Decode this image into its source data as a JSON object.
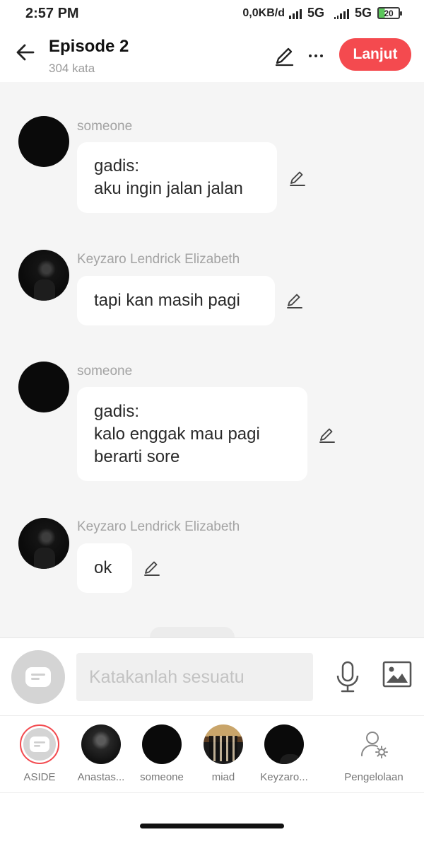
{
  "status_bar": {
    "time": "2:57 PM",
    "data_speed": "0,0KB/d",
    "network_1": "5G",
    "network_2": "5G",
    "battery": "20"
  },
  "header": {
    "title": "Episode 2",
    "word_count": "304 kata",
    "next_label": "Lanjut",
    "accent_color": "#f44a4f"
  },
  "messages": [
    {
      "sender": "someone",
      "lines": [
        "gadis:",
        "aku ingin jalan jalan"
      ]
    },
    {
      "sender": "Keyzaro Lendrick Elizabeth",
      "lines": [
        "tapi kan masih pagi"
      ]
    },
    {
      "sender": "someone",
      "lines": [
        "gadis:",
        "kalo enggak mau pagi",
        "berarti sore"
      ]
    },
    {
      "sender": "Keyzaro Lendrick Elizabeth",
      "lines": [
        "ok"
      ]
    }
  ],
  "input": {
    "placeholder": "Katakanlah sesuatu",
    "value": ""
  },
  "characters": [
    {
      "label": "ASIDE",
      "icon": "aside-icon",
      "selected": true
    },
    {
      "label": "Anastas...",
      "icon": "avatar"
    },
    {
      "label": "someone",
      "icon": "avatar"
    },
    {
      "label": "miad",
      "icon": "avatar"
    },
    {
      "label": "Keyzaro...",
      "icon": "avatar"
    }
  ],
  "management": {
    "label": "Pengelolaan",
    "icon": "user-gear-icon"
  }
}
